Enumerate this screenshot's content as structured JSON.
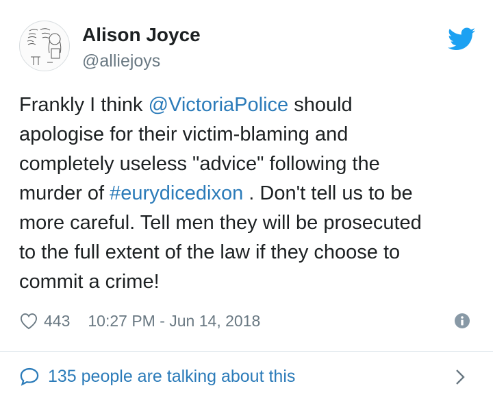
{
  "author": {
    "name": "Alison Joyce",
    "handle": "@alliejoys",
    "avatar_icon": "sketch-avatar-icon"
  },
  "brand": {
    "icon": "twitter-bird-icon",
    "color": "#1da1f2"
  },
  "tweet": {
    "segments": [
      {
        "text": "Frankly I think ",
        "type": "text"
      },
      {
        "text": "@VictoriaPolice",
        "type": "mention"
      },
      {
        "text": " should\napologise for their victim-blaming and\ncompletely useless \"advice\" following the\nmurder of ",
        "type": "text"
      },
      {
        "text": "#eurydicedixon",
        "type": "hashtag"
      },
      {
        "text": " . Don't tell us to be\nmore careful. Tell men they will be prosecuted\nto the full extent of the law if they choose to\ncommit a crime!",
        "type": "text"
      }
    ]
  },
  "meta": {
    "like_count": "443",
    "timestamp": "10:27 PM - Jun 14, 2018",
    "heart_icon": "heart-icon",
    "info_icon": "info-icon"
  },
  "footer": {
    "talking_label": "135 people are talking about this",
    "bubble_icon": "speech-bubble-icon",
    "chevron_icon": "chevron-right-icon"
  },
  "colors": {
    "link": "#2b7bb9",
    "text": "#1c2022",
    "muted": "#697882",
    "divider": "#e1e8ed"
  }
}
